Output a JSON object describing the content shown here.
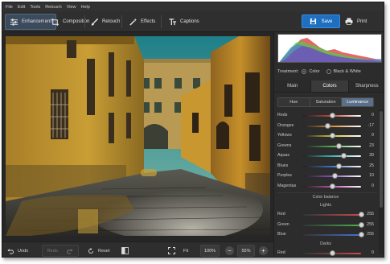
{
  "menu": [
    "File",
    "Edit",
    "Tools",
    "Retouch",
    "View",
    "Help"
  ],
  "toolbar": {
    "tabs": [
      {
        "label": "Enhancement",
        "icon": "sliders-icon",
        "active": true
      },
      {
        "label": "Composition",
        "icon": "crop-icon",
        "active": false
      },
      {
        "label": "Retouch",
        "icon": "brush-icon",
        "active": false
      },
      {
        "label": "Effects",
        "icon": "magic-wand-icon",
        "active": false
      },
      {
        "label": "Captions",
        "icon": "text-icon",
        "active": false
      }
    ],
    "save_label": "Save",
    "print_label": "Print"
  },
  "bottombar": {
    "undo_label": "Undo",
    "redo_label": "Redo",
    "reset_label": "Reset",
    "fit_label": "Fit",
    "zoom_100": "100%",
    "zoom_current": "55%",
    "zoom_out": "−",
    "zoom_in": "+"
  },
  "panel": {
    "treatment_label": "Treatment:",
    "treatment_options": [
      "Color",
      "Black & White"
    ],
    "treatment_selected": "Color",
    "tabs": [
      "Main",
      "Colors",
      "Sharpness"
    ],
    "active_tab": "Colors",
    "subtabs": [
      "Hue",
      "Saturation",
      "Luminance"
    ],
    "active_subtab": "Luminance",
    "luminance": [
      {
        "label": "Reds",
        "value": "0",
        "color": "#c74a3a",
        "pos": 0.5
      },
      {
        "label": "Oranges",
        "value": "-17",
        "color": "#d88a3a",
        "pos": 0.42
      },
      {
        "label": "Yellows",
        "value": "0",
        "color": "#d3c43a",
        "pos": 0.5
      },
      {
        "label": "Greens",
        "value": "23",
        "color": "#54b050",
        "pos": 0.62
      },
      {
        "label": "Aquas",
        "value": "39",
        "color": "#3fb3b3",
        "pos": 0.7
      },
      {
        "label": "Blues",
        "value": "25",
        "color": "#3f6fd0",
        "pos": 0.62
      },
      {
        "label": "Purples",
        "value": "10",
        "color": "#8a4fc7",
        "pos": 0.55
      },
      {
        "label": "Magentas",
        "value": "0",
        "color": "#c74fa8",
        "pos": 0.5
      }
    ],
    "color_balance_label": "Color balance",
    "lights_label": "Lights",
    "lights": [
      {
        "label": "Red",
        "value": "255",
        "color": "#c94b4b"
      },
      {
        "label": "Green",
        "value": "255",
        "color": "#4bb24b"
      },
      {
        "label": "Blue",
        "value": "255",
        "color": "#4b70d0"
      }
    ],
    "darks_label": "Darks",
    "darks": [
      {
        "label": "Red",
        "value": "0",
        "color": "#c94b4b"
      }
    ]
  },
  "colors": {
    "accent": "#1f6fc0",
    "active_tab": "#3b4a5c",
    "active_subtab": "#5a6f88"
  }
}
